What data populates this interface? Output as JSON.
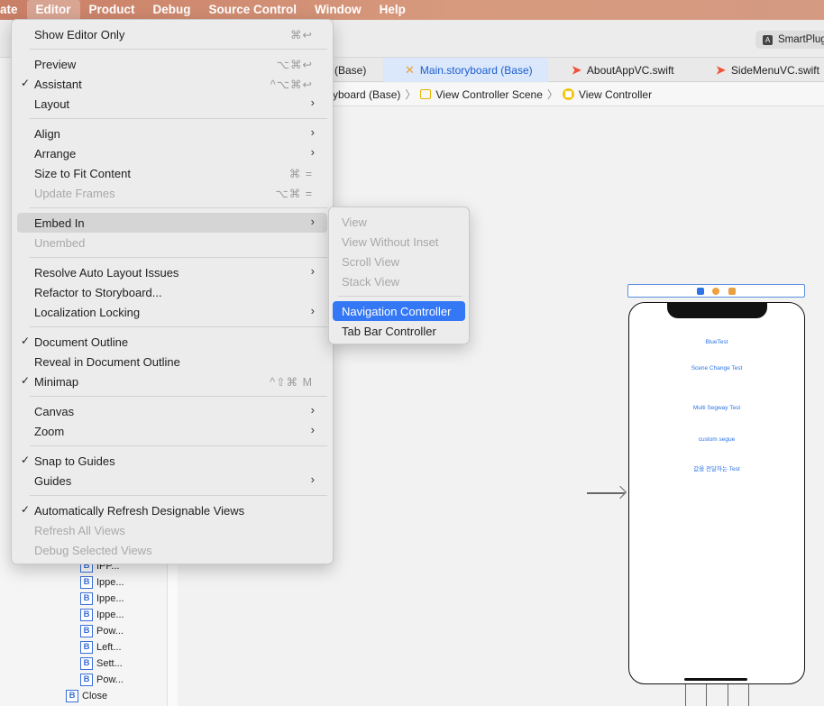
{
  "menubar": {
    "items": [
      "ate",
      "Editor",
      "Product",
      "Debug",
      "Source Control",
      "Window",
      "Help"
    ],
    "active_index": 1
  },
  "toolbar": {
    "scheme_label": "SmartPlug"
  },
  "tabs": [
    {
      "label": "(Base)",
      "icon": "",
      "active": false
    },
    {
      "label": "Main.storyboard (Base)",
      "icon": "storyboard-icon",
      "active": true
    },
    {
      "label": "AboutAppVC.swift",
      "icon": "swift-icon",
      "active": false
    },
    {
      "label": "SideMenuVC.swift",
      "icon": "swift-icon",
      "active": false
    }
  ],
  "jumpbar": {
    "items": [
      "yboard (Base)",
      "View Controller Scene",
      "View Controller"
    ],
    "separator": "〉"
  },
  "navigator": {
    "rows": [
      "IPP...",
      "Ippe...",
      "Ippe...",
      "Ippe...",
      "Pow...",
      "Left...",
      "Sett...",
      "Pow...",
      "Close"
    ],
    "badge": "B"
  },
  "editor_menu": {
    "sections": [
      [
        {
          "label": "Show Editor Only",
          "shortcut": "⌘↩",
          "checked": false,
          "disabled": false,
          "submenu": false
        }
      ],
      [
        {
          "label": "Preview",
          "shortcut": "⌥⌘↩",
          "checked": false,
          "disabled": false,
          "submenu": false
        },
        {
          "label": "Assistant",
          "shortcut": "^⌥⌘↩",
          "checked": true,
          "disabled": false,
          "submenu": false
        },
        {
          "label": "Layout",
          "shortcut": "",
          "checked": false,
          "disabled": false,
          "submenu": true
        }
      ],
      [
        {
          "label": "Align",
          "shortcut": "",
          "checked": false,
          "disabled": false,
          "submenu": true
        },
        {
          "label": "Arrange",
          "shortcut": "",
          "checked": false,
          "disabled": false,
          "submenu": true
        },
        {
          "label": "Size to Fit Content",
          "shortcut": "⌘ =",
          "checked": false,
          "disabled": false,
          "submenu": false
        },
        {
          "label": "Update Frames",
          "shortcut": "⌥⌘ =",
          "checked": false,
          "disabled": true,
          "submenu": false
        }
      ],
      [
        {
          "label": "Embed In",
          "shortcut": "",
          "checked": false,
          "disabled": false,
          "submenu": true,
          "highlighted": true
        },
        {
          "label": "Unembed",
          "shortcut": "",
          "checked": false,
          "disabled": true,
          "submenu": false
        }
      ],
      [
        {
          "label": "Resolve Auto Layout Issues",
          "shortcut": "",
          "checked": false,
          "disabled": false,
          "submenu": true
        },
        {
          "label": "Refactor to Storyboard...",
          "shortcut": "",
          "checked": false,
          "disabled": false,
          "submenu": false
        },
        {
          "label": "Localization Locking",
          "shortcut": "",
          "checked": false,
          "disabled": false,
          "submenu": true
        }
      ],
      [
        {
          "label": "Document Outline",
          "shortcut": "",
          "checked": true,
          "disabled": false,
          "submenu": false
        },
        {
          "label": "Reveal in Document Outline",
          "shortcut": "",
          "checked": false,
          "disabled": false,
          "submenu": false
        },
        {
          "label": "Minimap",
          "shortcut": "^⇧⌘ M",
          "checked": true,
          "disabled": false,
          "submenu": false
        }
      ],
      [
        {
          "label": "Canvas",
          "shortcut": "",
          "checked": false,
          "disabled": false,
          "submenu": true
        },
        {
          "label": "Zoom",
          "shortcut": "",
          "checked": false,
          "disabled": false,
          "submenu": true
        }
      ],
      [
        {
          "label": "Snap to Guides",
          "shortcut": "",
          "checked": true,
          "disabled": false,
          "submenu": false
        },
        {
          "label": "Guides",
          "shortcut": "",
          "checked": false,
          "disabled": false,
          "submenu": true
        }
      ],
      [
        {
          "label": "Automatically Refresh Designable Views",
          "shortcut": "",
          "checked": true,
          "disabled": false,
          "submenu": false
        },
        {
          "label": "Refresh All Views",
          "shortcut": "",
          "checked": false,
          "disabled": true,
          "submenu": false
        },
        {
          "label": "Debug Selected Views",
          "shortcut": "",
          "checked": false,
          "disabled": true,
          "submenu": false
        }
      ]
    ]
  },
  "embed_submenu": {
    "sections": [
      [
        {
          "label": "View",
          "disabled": true,
          "selected": false
        },
        {
          "label": "View Without Inset",
          "disabled": true,
          "selected": false
        },
        {
          "label": "Scroll View",
          "disabled": true,
          "selected": false
        },
        {
          "label": "Stack View",
          "disabled": true,
          "selected": false
        }
      ],
      [
        {
          "label": "Navigation Controller",
          "disabled": false,
          "selected": true
        },
        {
          "label": "Tab Bar Controller",
          "disabled": false,
          "selected": false
        }
      ]
    ]
  },
  "phone": {
    "buttons": [
      "BlueTest",
      "Scene Change Test",
      "Multi Segway Test",
      "custom segue",
      "값을 전달하는 Test"
    ]
  },
  "colors": {
    "accent": "#3478f6",
    "menubar": "#c97f66"
  }
}
